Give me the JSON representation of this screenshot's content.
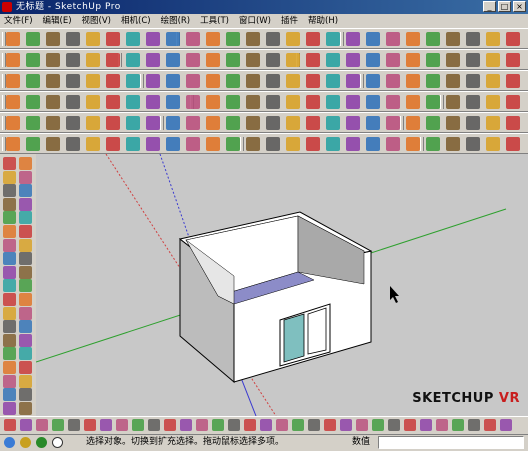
{
  "window": {
    "title": "无标题 - SketchUp Pro",
    "minimize": "_",
    "maximize": "□",
    "close": "×"
  },
  "menu": [
    "文件(F)",
    "编辑(E)",
    "视图(V)",
    "相机(C)",
    "绘图(R)",
    "工具(T)",
    "窗口(W)",
    "插件",
    "帮助(H)"
  ],
  "viewport": {
    "watermark_main": "SKETCHUP ",
    "watermark_accent": "VR",
    "axis_colors": {
      "red": "#d04040",
      "green": "#2ea02e",
      "blue": "#3a3ad0"
    }
  },
  "status": {
    "message": "选择对象。切换到扩充选择。拖动鼠标选择多项。",
    "measure_label": "数值",
    "measure_value": ""
  }
}
